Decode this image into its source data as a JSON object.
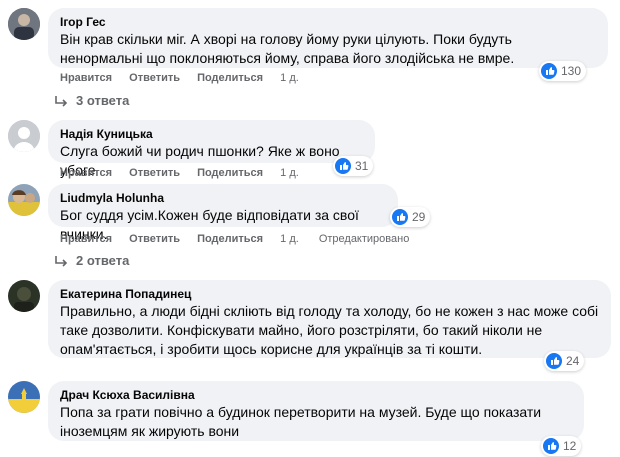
{
  "comments": [
    {
      "author": "Ігор Гес",
      "lines": [
        "Він крав скільки міг. А хворі на голову йому руки цілують. Поки будуть",
        "ненормальні що поклоняються йому, справа його злодійська не вмре."
      ],
      "actions": {
        "like": "Нравится",
        "reply": "Ответить",
        "share": "Поделиться",
        "time": "1 д."
      },
      "likes": "130",
      "replies": "3 ответа"
    },
    {
      "author": "Надія Куницька",
      "lines": [
        "Слуга божий чи родич пшонки? Яке ж воно убоге"
      ],
      "actions": {
        "like": "Нравится",
        "reply": "Ответить",
        "share": "Поделиться",
        "time": "1 д."
      },
      "likes": "31"
    },
    {
      "author": "Liudmyla Holunha",
      "lines": [
        "Бог суддя усім.Кожен буде відповідати за свої вчинки."
      ],
      "actions": {
        "like": "Нравится",
        "reply": "Ответить",
        "share": "Поделиться",
        "time": "1 д.",
        "edited": "Отредактировано"
      },
      "likes": "29",
      "replies": "2 ответа"
    },
    {
      "author": "Екатерина Попадинец",
      "lines": [
        "Правильно, а люди бідні скліють від голоду та холоду, бо не кожен з нас може собі",
        "таке дозволити. Конфіскувати майно, його розстріляти, бо такий ніколи не",
        "опам'ятається, і зробити щось корисне для українців за ті кошти."
      ],
      "likes": "24"
    },
    {
      "author": "Драч Ксюха Василівна",
      "lines": [
        "Попа за грати повічно а будинок перетворити на музей. Буде що показати",
        "іноземцям як жирують вони"
      ],
      "likes": "12"
    }
  ],
  "colors": {
    "bubble": "#f0f2f5",
    "meta": "#65676b",
    "like": "#1877f2"
  }
}
